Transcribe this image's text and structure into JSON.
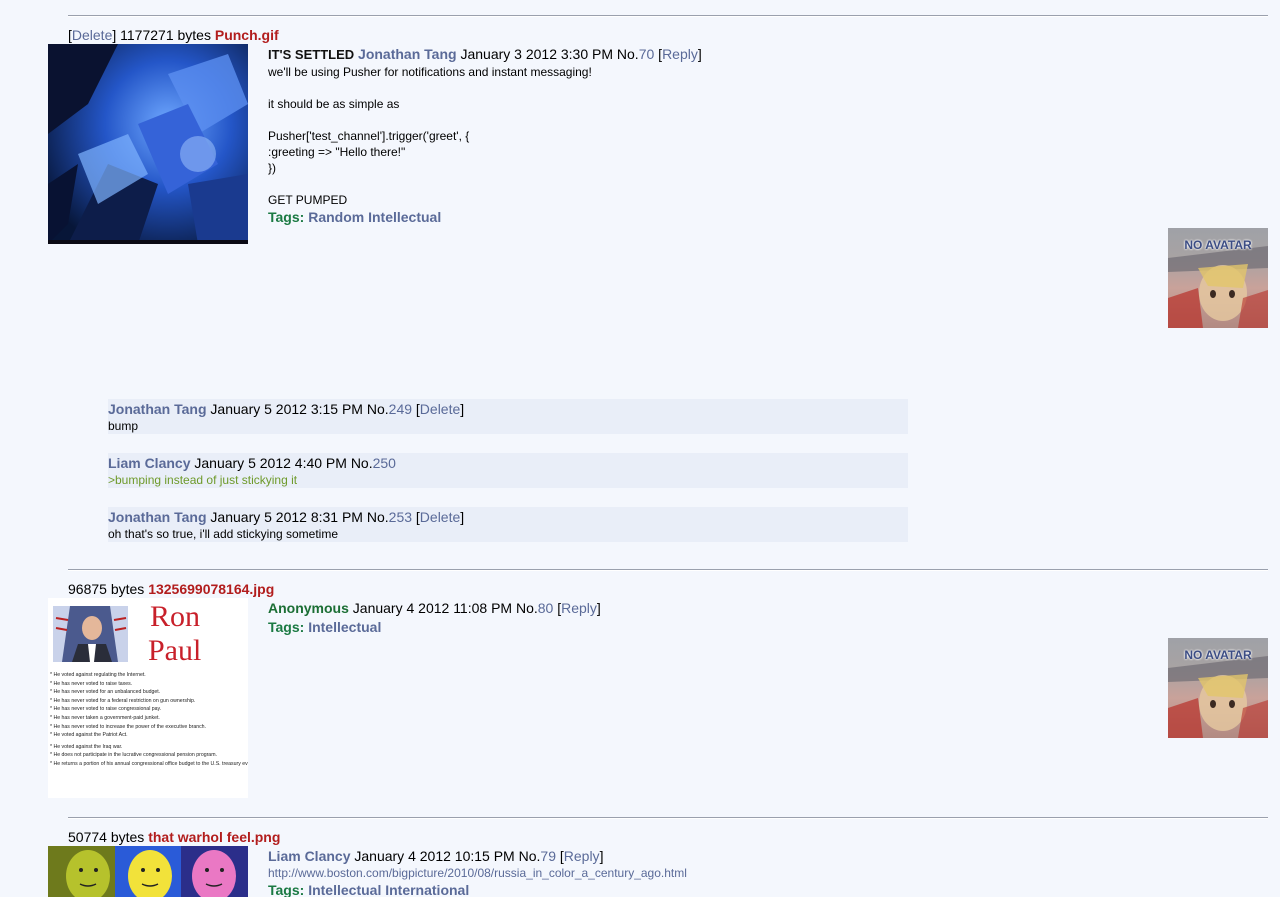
{
  "threads": [
    {
      "delete_label": "Delete",
      "filesize": "1177271 bytes",
      "filename": "Punch.gif",
      "op": {
        "subject": "IT'S SETTLED",
        "poster": "Jonathan Tang",
        "date": "January 3 2012 3:30 PM",
        "no_label": "No.",
        "number": "70",
        "reply_label": "Reply",
        "body": "we'll be using Pusher for notifications and instant messaging!\n\nit should be as simple as\n\nPusher['test_channel'].trigger('greet', {\n:greeting => \"Hello there!\"\n})\n\nGET PUMPED",
        "tags_label": "Tags:",
        "tags": "Random Intellectual"
      },
      "avatar_text": "NO AVATAR",
      "replies": [
        {
          "poster": "Jonathan Tang",
          "date": "January 5 2012 3:15 PM",
          "no_label": "No.",
          "number": "249",
          "delete_label": "Delete",
          "body": "bump"
        },
        {
          "poster": "Liam Clancy",
          "date": "January 5 2012 4:40 PM",
          "no_label": "No.",
          "number": "250",
          "body": ">bumping instead of just stickying it"
        },
        {
          "poster": "Jonathan Tang",
          "date": "January 5 2012 8:31 PM",
          "no_label": "No.",
          "number": "253",
          "delete_label": "Delete",
          "body": "oh that's so true, i'll add stickying sometime"
        }
      ]
    },
    {
      "filesize": "96875 bytes",
      "filename": "1325699078164.jpg",
      "thumb_text": {
        "title_line1": "Ron",
        "title_line2": "Paul",
        "bullets": [
          "* He voted against regulating the Internet.",
          "* He has never voted to raise taxes.",
          "* He has never voted for an unbalanced budget.",
          "* He has never voted for a federal restriction on gun ownership.",
          "* He has never voted to raise congressional pay.",
          "* He has never taken a government-paid junket.",
          "* He has never voted to increase the power of the executive branch.",
          "* He voted against the Patriot Act.",
          "* He voted against the Iraq war.",
          "* He does not participate in the lucrative congressional pension program.",
          "* He returns a portion of his annual congressional office budget to the U.S. treasury every year."
        ]
      },
      "op": {
        "poster": "Anonymous",
        "date": "January 4 2012 11:08 PM",
        "no_label": "No.",
        "number": "80",
        "reply_label": "Reply",
        "tags_label": "Tags:",
        "tags": "Intellectual"
      },
      "avatar_text": "NO AVATAR"
    },
    {
      "filesize": "50774 bytes",
      "filename": "that warhol feel.png",
      "op": {
        "poster": "Liam Clancy",
        "date": "January 4 2012 10:15 PM",
        "no_label": "No.",
        "number": "79",
        "reply_label": "Reply",
        "link": "http://www.boston.com/bigpicture/2010/08/russia_in_color_a_century_ago.html",
        "tags_label": "Tags:",
        "tags": "Intellectual International"
      }
    }
  ],
  "colors": {
    "background": "#f4f7fd",
    "link": "#5a6a98",
    "filename": "#b21d1d",
    "tag_label": "#1b7a43",
    "anonymous": "#1b6e34",
    "greentext": "#6e9a2a",
    "reply_bg": "#e9eef8"
  }
}
